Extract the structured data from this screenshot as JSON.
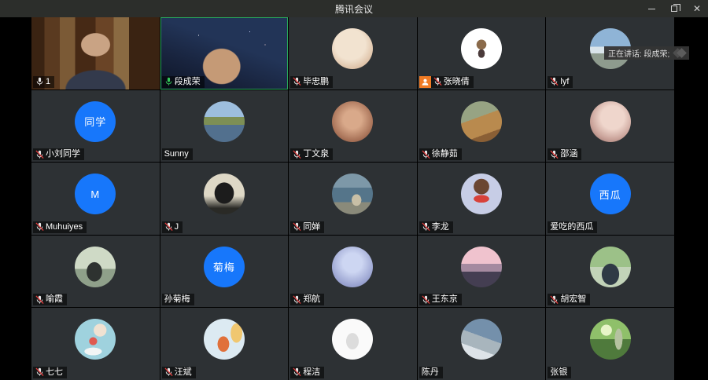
{
  "window": {
    "title": "腾讯会议",
    "controls": [
      "minimize-icon",
      "maximize-icon",
      "close-icon"
    ]
  },
  "toast": {
    "text": "正在讲话: 段成荣;"
  },
  "colors": {
    "titlebar_bg": "#2c2e2b",
    "tile_bg": "#2d3134",
    "initial_bg": "#1777fb",
    "speaking_green": "#28a95c",
    "muted_red": "#e23b3b",
    "host_badge_orange": "#f07b24"
  },
  "tiles": [
    {
      "name": "1",
      "mic": "on",
      "badge": null,
      "avatar": {
        "type": "video",
        "css": "radial-gradient(ellipse 30px 24px at 50% 38%, #c9a384 60%, rgba(0,0,0,0) 63%), radial-gradient(ellipse 62px 40px at 50% 100%, #333a4c 60%, rgba(0,0,0,0) 63%), linear-gradient(90deg, #3a2312 0 10%, #5a3a20 10% 22%, #7b5a36 22% 34%, #462915 34% 50%, #6a4426 50% 64%, #8a6a42 64% 76%, #3a2312 76%)"
      }
    },
    {
      "name": "段成荣",
      "mic": "speaking",
      "badge": null,
      "speaking": true,
      "avatar": {
        "type": "video",
        "css": "radial-gradient(ellipse 40px 38px at 48% 68%, #c59a76 58%, rgba(0,0,0,0) 61%), radial-gradient(circle 1px at 70% 20%, #cfd8ff 50%, rgba(0,0,0,0) 60%), radial-gradient(circle 1px at 82% 38%, #ffd8d8 50%, rgba(0,0,0,0) 60%), radial-gradient(circle 1px at 30% 25%, #ffffff 50%, rgba(0,0,0,0) 60%), linear-gradient(200deg, #223457 0 40%, #18233d 70%, #0d1526)"
      }
    },
    {
      "name": "毕忠鹏",
      "mic": "muted",
      "badge": null,
      "avatar": {
        "type": "photo",
        "css": "radial-gradient(circle at 45% 40%, #f2e3d0 0 45%, #dcbfa4 75%, #caa183)"
      }
    },
    {
      "name": "张晓倩",
      "mic": "muted",
      "badge": "host",
      "avatar": {
        "type": "photo",
        "css": "radial-gradient(circle at 50% 40%, #8a6a4a 0 15%, rgba(0,0,0,0) 16%), radial-gradient(ellipse 7px 9px at 50% 62%, #4a3a3a 0 60%, rgba(0,0,0,0) 62%), linear-gradient(180deg, #ffffff 0 100%)"
      }
    },
    {
      "name": "lyf",
      "mic": "muted",
      "badge": null,
      "avatar": {
        "type": "photo",
        "css": "linear-gradient(180deg, #8fb4d6 0 45%, #d9e4ea 45% 62%, #8e9b8e 62%)"
      }
    },
    {
      "name": "小刘同学",
      "mic": "muted",
      "badge": null,
      "avatar": {
        "type": "initial",
        "text": "同学"
      }
    },
    {
      "name": "Sunny",
      "mic": "none",
      "badge": null,
      "avatar": {
        "type": "photo",
        "css": "linear-gradient(180deg, #9dbede 0 38%, #7d8f55 38% 58%, #52708e 58%)"
      }
    },
    {
      "name": "丁文泉",
      "mic": "muted",
      "badge": null,
      "avatar": {
        "type": "photo",
        "css": "radial-gradient(circle at 50% 45%, #d9a98a 0 30%, #a56f55 70%, #7a4a3a)"
      }
    },
    {
      "name": "徐静茹",
      "mic": "muted",
      "badge": null,
      "avatar": {
        "type": "photo",
        "css": "linear-gradient(160deg, #97a383 0 40%, #b98a4e 40% 75%, #8a5f35 75%)"
      }
    },
    {
      "name": "邵涵",
      "mic": "muted",
      "badge": null,
      "avatar": {
        "type": "photo",
        "css": "radial-gradient(circle at 55% 40%, #efd6cc 0 35%, #caa39a 65%, #8a625c)"
      }
    },
    {
      "name": "Muhuiyes",
      "mic": "muted",
      "badge": null,
      "avatar": {
        "type": "initial",
        "text": "M"
      }
    },
    {
      "name": "J",
      "mic": "muted",
      "badge": null,
      "avatar": {
        "type": "photo",
        "css": "radial-gradient(ellipse 20px 22px at 50% 48%, #1c1c1c 0 60%, rgba(0,0,0,0) 63%), linear-gradient(180deg, #ded8c6 0 55%, #2a2a26 85%)"
      }
    },
    {
      "name": "同婵",
      "mic": "muted",
      "badge": null,
      "avatar": {
        "type": "photo",
        "css": "radial-gradient(ellipse 10px 12px at 60% 65%, #c8bfa6 0 60%, rgba(0,0,0,0) 63%), linear-gradient(180deg, #7d98a8 0 35%, #55758a 35% 70%, #8a8a7a 70%)"
      }
    },
    {
      "name": "李龙",
      "mic": "muted",
      "badge": null,
      "avatar": {
        "type": "photo",
        "css": "radial-gradient(circle at 50% 32%, #6b4632 0 22%, rgba(0,0,0,0) 23%), radial-gradient(ellipse 16px 8px at 50% 62%, #d8413a 0 60%, rgba(0,0,0,0) 63%), linear-gradient(180deg, #c7cde6 0 100%)"
      }
    },
    {
      "name": "爱吃的西瓜",
      "mic": "none",
      "badge": null,
      "avatar": {
        "type": "initial",
        "text": "西瓜"
      }
    },
    {
      "name": "喻霞",
      "mic": "muted",
      "badge": null,
      "avatar": {
        "type": "photo",
        "css": "radial-gradient(ellipse 16px 20px at 48% 62%, #2e3230 0 60%, rgba(0,0,0,0) 63%), linear-gradient(180deg, #cfdac6 0 55%, #8fa08a 55%)"
      }
    },
    {
      "name": "孙菊梅",
      "mic": "none",
      "badge": null,
      "avatar": {
        "type": "initial",
        "text": "菊梅"
      }
    },
    {
      "name": "郑航",
      "mic": "muted",
      "badge": null,
      "avatar": {
        "type": "photo",
        "css": "radial-gradient(circle at 50% 40%, #cdd6f2 0 30%, #9aa3d0 70%, #7a83b5)"
      }
    },
    {
      "name": "王东京",
      "mic": "muted",
      "badge": null,
      "avatar": {
        "type": "photo",
        "css": "linear-gradient(180deg, #f0c3ce 0 42%, #a58aa0 42% 62%, #443e52 62%)"
      }
    },
    {
      "name": "胡宏智",
      "mic": "muted",
      "badge": null,
      "avatar": {
        "type": "photo",
        "css": "radial-gradient(ellipse 18px 22px at 50% 68%, #2f3a45 0 60%, rgba(0,0,0,0) 63%), linear-gradient(180deg, #9cc188 0 50%, #c2d3b8 50%)"
      }
    },
    {
      "name": "七七",
      "mic": "muted",
      "badge": null,
      "avatar": {
        "type": "photo",
        "css": "radial-gradient(circle at 62% 28%, #f0e2d2 0 16%, rgba(0,0,0,0) 17%), radial-gradient(circle at 45% 55%, #e05a50 0 12%, rgba(0,0,0,0) 13%), radial-gradient(ellipse 18px 8px at 45% 80%, #f2f5f5 0 60%, rgba(0,0,0,0) 63%), linear-gradient(180deg, #9fd2de 0 100%)"
      }
    },
    {
      "name": "汪斌",
      "mic": "muted",
      "badge": null,
      "avatar": {
        "type": "photo",
        "css": "radial-gradient(ellipse 12px 16px at 48% 62%, #e0703a 0 60%, rgba(0,0,0,0) 63%), radial-gradient(ellipse 12px 20px at 80% 35%, #f0c770 0 60%, rgba(0,0,0,0) 63%), linear-gradient(180deg, #dceaf2 0 100%)"
      }
    },
    {
      "name": "程洁",
      "mic": "muted",
      "badge": null,
      "avatar": {
        "type": "photo",
        "css": "radial-gradient(ellipse 13px 17px at 50% 55%, #dcdcdc 0 60%, rgba(0,0,0,0) 63%), linear-gradient(180deg, #fafafa 0 100%)"
      }
    },
    {
      "name": "陈丹",
      "mic": "none",
      "badge": null,
      "avatar": {
        "type": "photo",
        "css": "linear-gradient(200deg, #7490ab 0 45%, #a8b5bd 45% 70%, #dde3e8 70%)"
      }
    },
    {
      "name": "张银",
      "mic": "none",
      "badge": null,
      "avatar": {
        "type": "photo",
        "css": "radial-gradient(circle at 40% 28%, #e8f5c8 0 14%, rgba(0,0,0,0) 15%), radial-gradient(ellipse 8px 22px at 70% 50%, #b5c2a0 0 60%, rgba(0,0,0,0) 63%), linear-gradient(180deg, #8fc06a 0 50%, #4f7a3c 50%)"
      }
    }
  ]
}
